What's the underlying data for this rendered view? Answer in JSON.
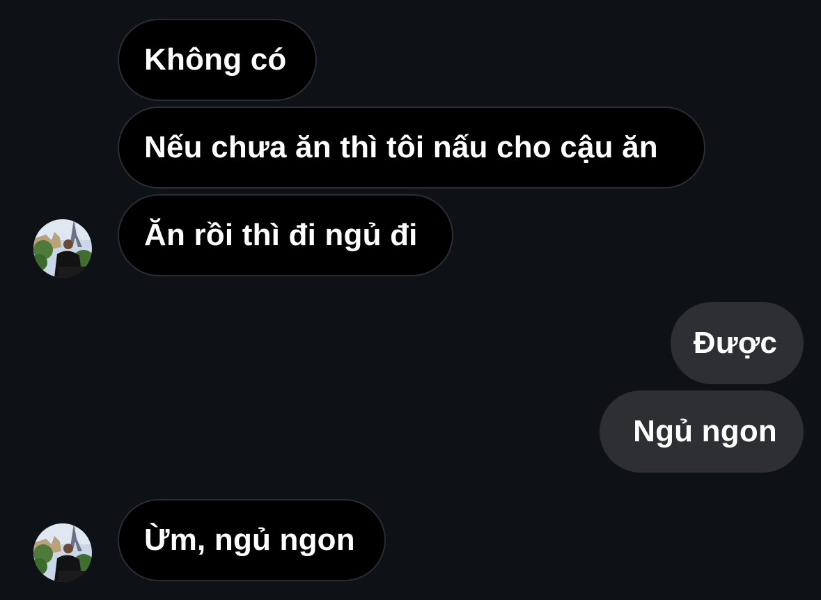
{
  "conversation": {
    "messages": [
      {
        "sender": "other",
        "text": "Không có"
      },
      {
        "sender": "other",
        "text": "Nếu chưa ăn thì tôi nấu cho cậu ăn"
      },
      {
        "sender": "other",
        "text": "Ăn rồi thì đi ngủ đi"
      },
      {
        "sender": "me",
        "text": "Được"
      },
      {
        "sender": "me",
        "text": "Ngủ ngon"
      },
      {
        "sender": "other",
        "text": "Ừm, ngủ ngon"
      }
    ]
  },
  "theme": {
    "background": "#0e1116",
    "received_bubble": "#000000",
    "received_border": "#2a2d33",
    "sent_bubble": "#2e2f32",
    "text": "#ffffff"
  },
  "icons": {
    "avatar": "contact-avatar-photo"
  }
}
